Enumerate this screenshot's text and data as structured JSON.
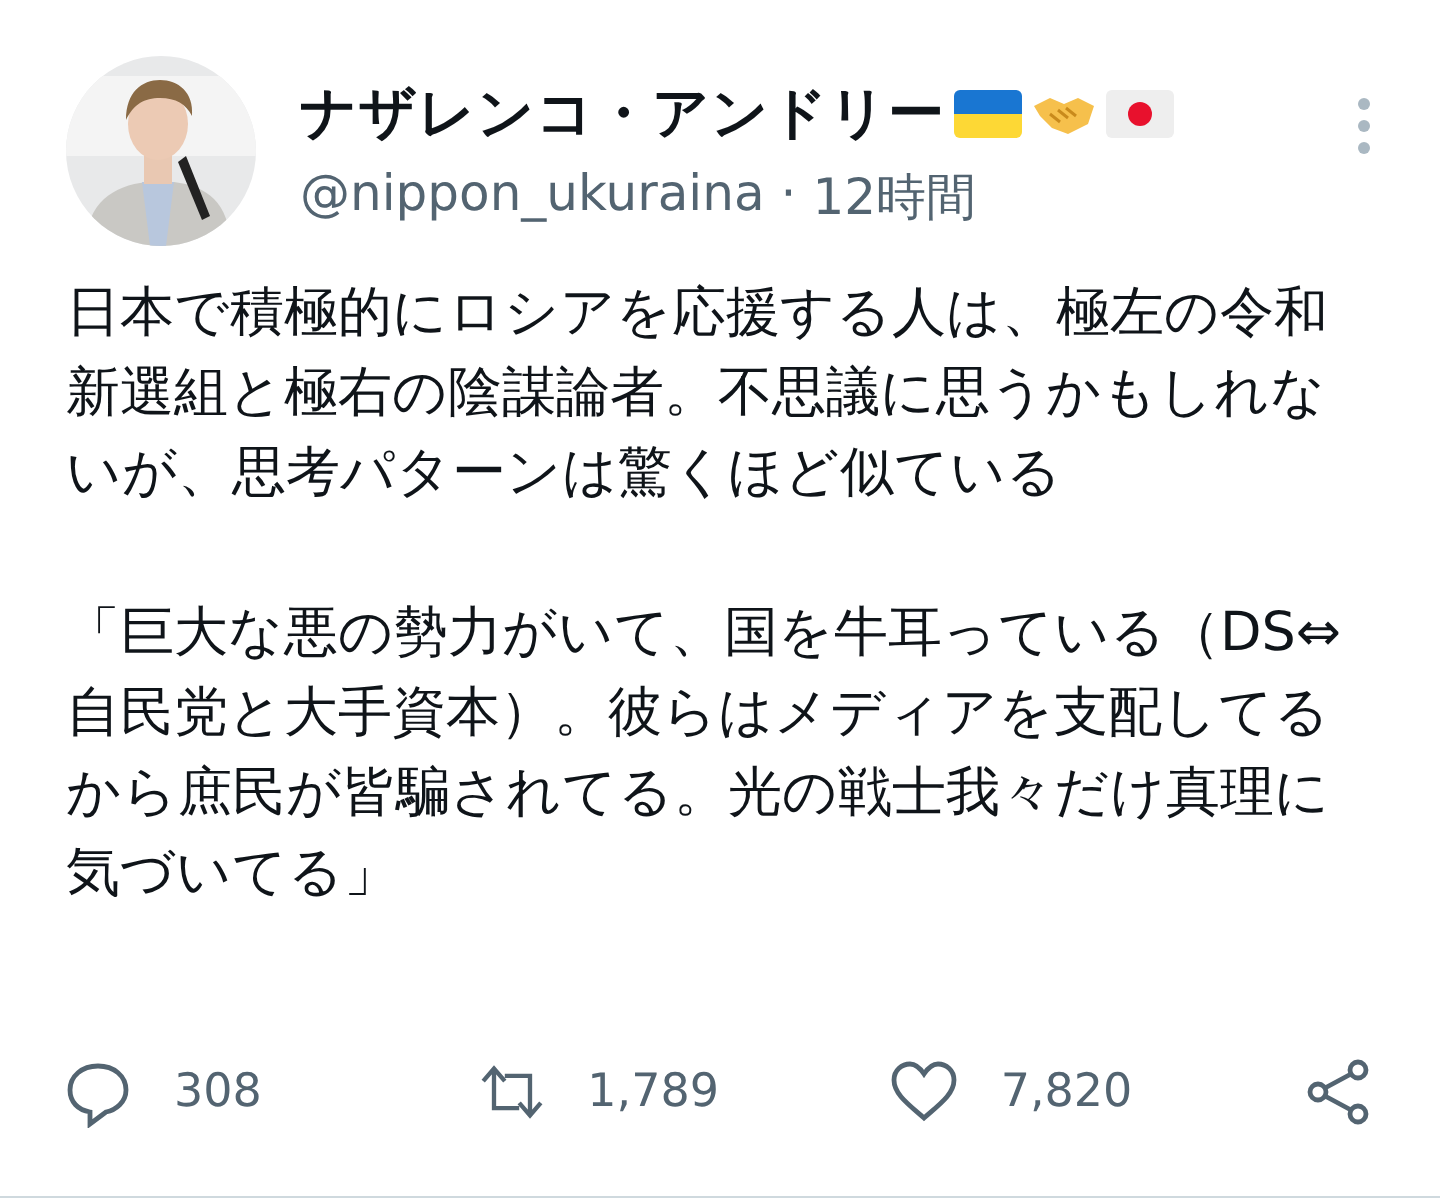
{
  "tweet": {
    "display_name": "ナザレンコ・アンドリー",
    "handle": "@nippon_ukuraina",
    "separator": "·",
    "time": "12時間",
    "paragraphs": [
      "日本で積極的にロシアを応援する人は、極左の令和新選組と極右の陰謀論者。不思議に思うかもしれないが、思考パターンは驚くほど似ている",
      "「巨大な悪の勢力がいて、国を牛耳っている（DS⇔自民党と大手資本）。彼らはメディアを支配してるから庶民が皆騙されてる。光の戦士我々だけ真理に気づいてる」"
    ],
    "actions": [
      {
        "kind": "reply",
        "count": "308"
      },
      {
        "kind": "retweet",
        "count": "1,789"
      },
      {
        "kind": "like",
        "count": "7,820"
      },
      {
        "kind": "share"
      }
    ]
  }
}
